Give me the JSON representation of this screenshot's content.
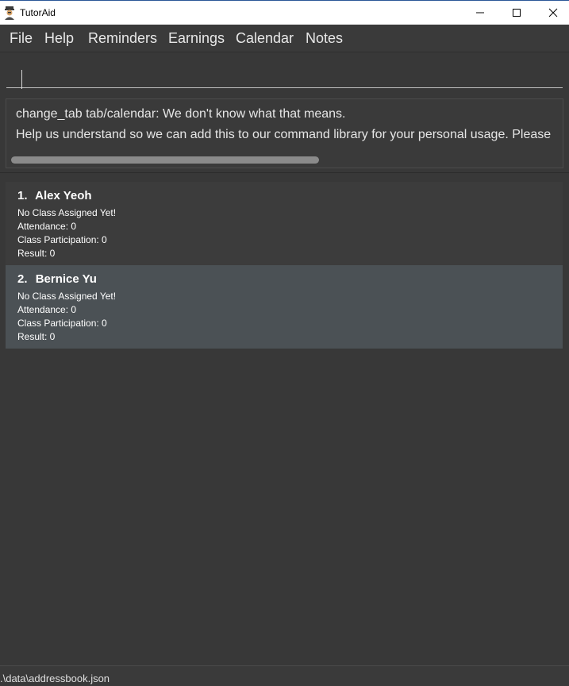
{
  "window": {
    "title": "TutorAid"
  },
  "menu": {
    "items": [
      "File",
      "Help",
      "Reminders",
      "Earnings",
      "Calendar",
      "Notes"
    ]
  },
  "command": {
    "value": ""
  },
  "result": {
    "line1": "change_tab tab/calendar: We don't know what that means.",
    "line2": "Help us understand so we can add this to our command library for your personal usage. Please"
  },
  "students": [
    {
      "index": "1.",
      "name": "Alex Yeoh",
      "class_status": "No Class Assigned Yet!",
      "attendance": "Attendance: 0",
      "participation": "Class Participation: 0",
      "result": "Result: 0",
      "selected": false
    },
    {
      "index": "2.",
      "name": "Bernice Yu",
      "class_status": "No Class Assigned Yet!",
      "attendance": "Attendance: 0",
      "participation": "Class Participation: 0",
      "result": "Result: 0",
      "selected": true
    }
  ],
  "status": {
    "file_path": ".\\data\\addressbook.json"
  },
  "colors": {
    "background": "#383838",
    "selected_card": "#4b5155",
    "text": "#ffffff"
  }
}
